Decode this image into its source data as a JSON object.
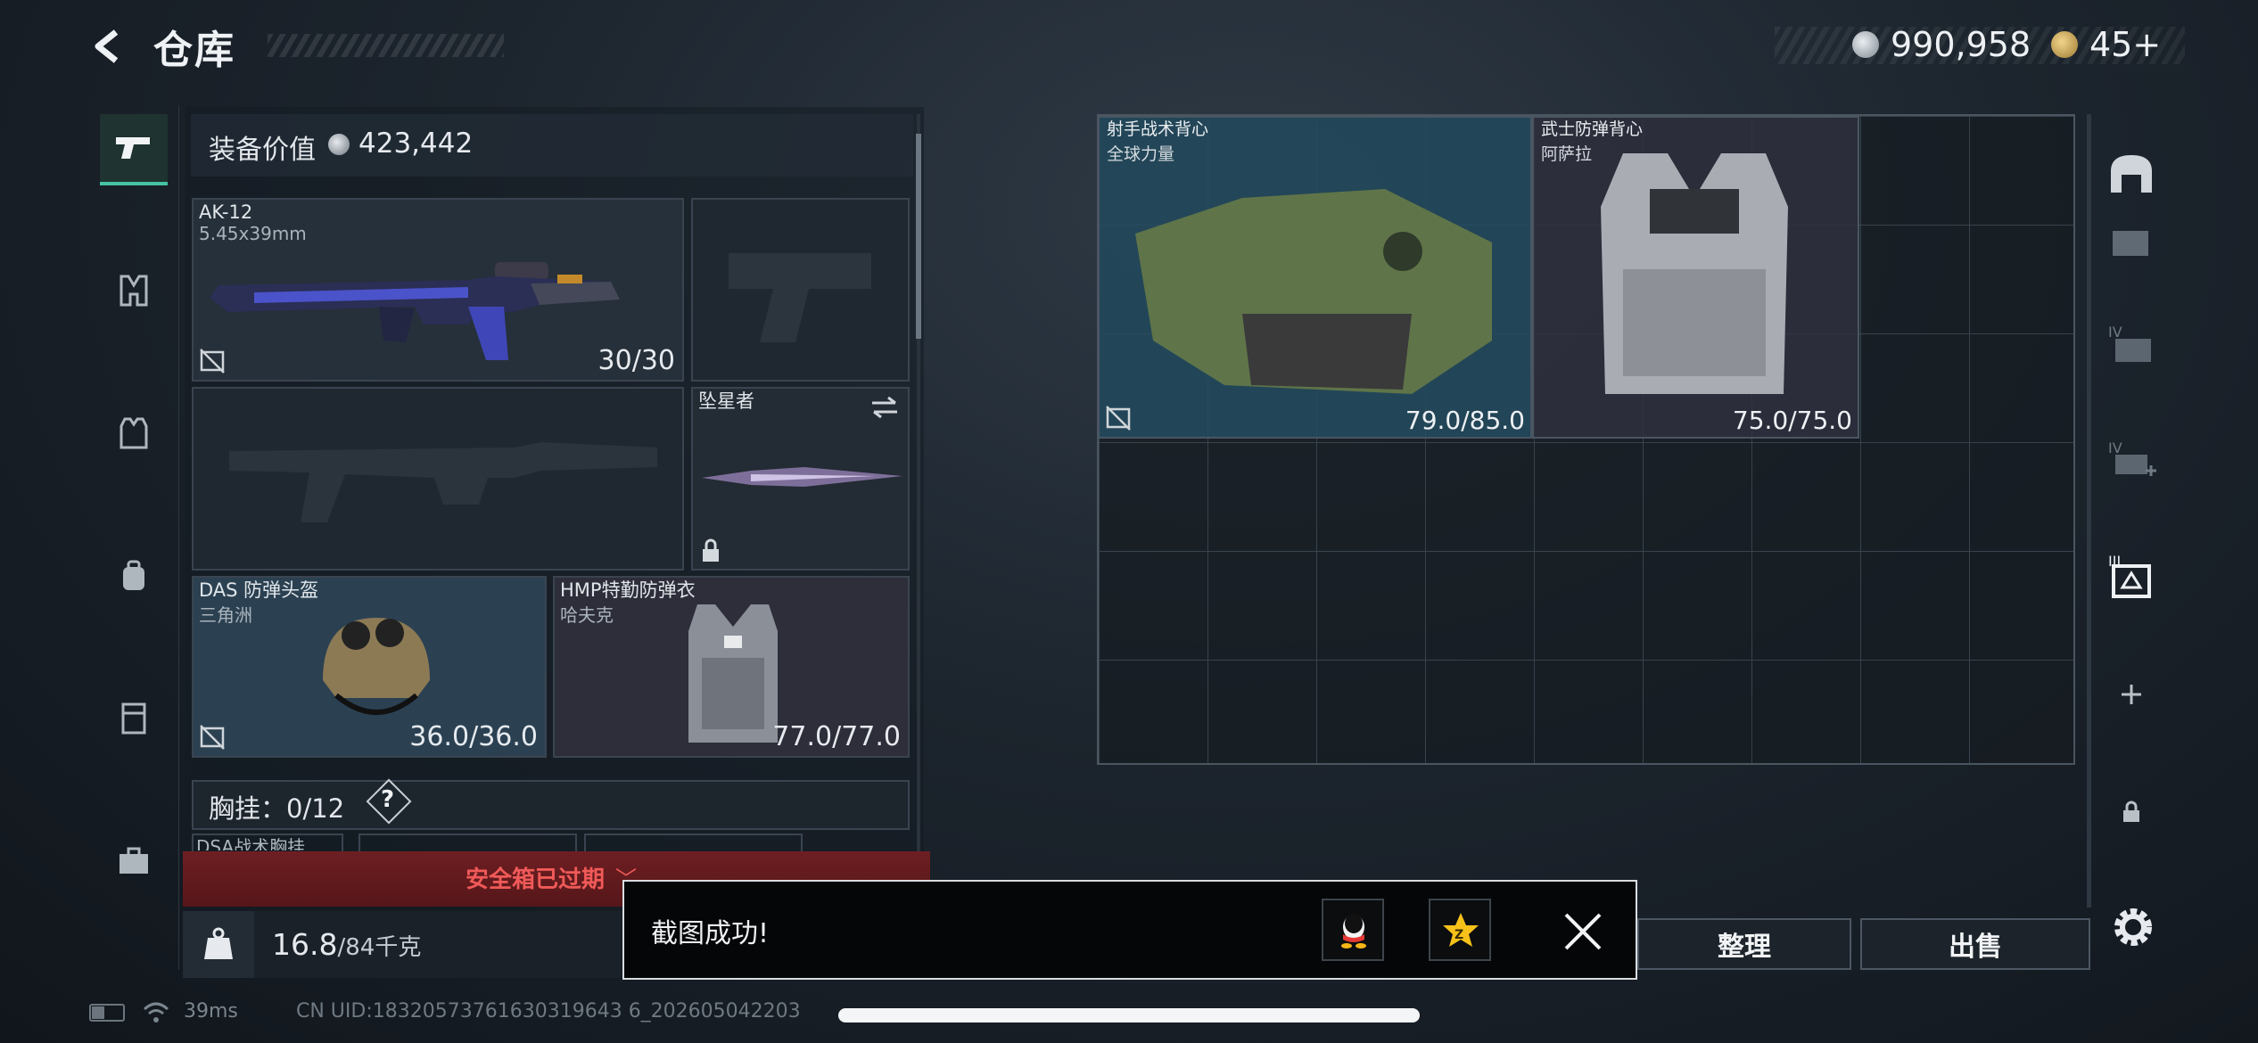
{
  "header": {
    "title": "仓库",
    "back_icon": "back-arrow-icon",
    "coin_value": "990,958",
    "ticket_value": "45+"
  },
  "left_sidebar": {
    "items": [
      {
        "icon": "pistol-icon",
        "active": true
      },
      {
        "icon": "chest-rig-icon",
        "active": false
      },
      {
        "icon": "armor-vest-icon",
        "active": false
      },
      {
        "icon": "backpack-icon",
        "active": false
      },
      {
        "icon": "container-icon",
        "active": false
      },
      {
        "icon": "briefcase-icon",
        "active": false
      }
    ]
  },
  "equipment": {
    "value_label": "装备价值",
    "value": "423,442",
    "primary": {
      "name": "AK-12",
      "caliber": "5.45x39mm",
      "ammo": "30/30"
    },
    "melee": {
      "name": "坠星者"
    },
    "helmet": {
      "name": "DAS 防弹头盔",
      "sub": "三角洲",
      "durability": "36.0/36.0"
    },
    "armor": {
      "name": "HMP特勤防弹衣",
      "sub": "哈夫克",
      "durability": "77.0/77.0"
    },
    "chest_rig": {
      "label": "胸挂：",
      "count": "0/12",
      "help": "?",
      "sub_item": "DSA战术胸挂"
    },
    "safebox_warning": "安全箱已过期",
    "weight": {
      "current": "16.8",
      "max": "/84千克"
    }
  },
  "storage": {
    "items": [
      {
        "name": "射手战术背心",
        "sub": "全球力量",
        "durability": "79.0/85.0"
      },
      {
        "name": "武士防弹背心",
        "sub": "阿萨拉",
        "durability": "75.0/75.0"
      }
    ]
  },
  "right_sidebar": {
    "items": [
      "storage-home-icon",
      "storage-tab-icon",
      "storage-iv-icon",
      "storage-iv-add-icon",
      "storage-iii-icon",
      "add-icon",
      "lock-icon"
    ]
  },
  "buttons": {
    "sort": "整理",
    "sell": "出售"
  },
  "toast": {
    "message": "截图成功!"
  },
  "status": {
    "ping": "39ms",
    "uid": "CN UID:18320573761630319643 6_202605042203"
  },
  "colors": {
    "accent": "#45c2a4",
    "warning": "#f05a58",
    "helmet_bg": "#2b4152",
    "armor_bg": "#2d2e3a"
  }
}
